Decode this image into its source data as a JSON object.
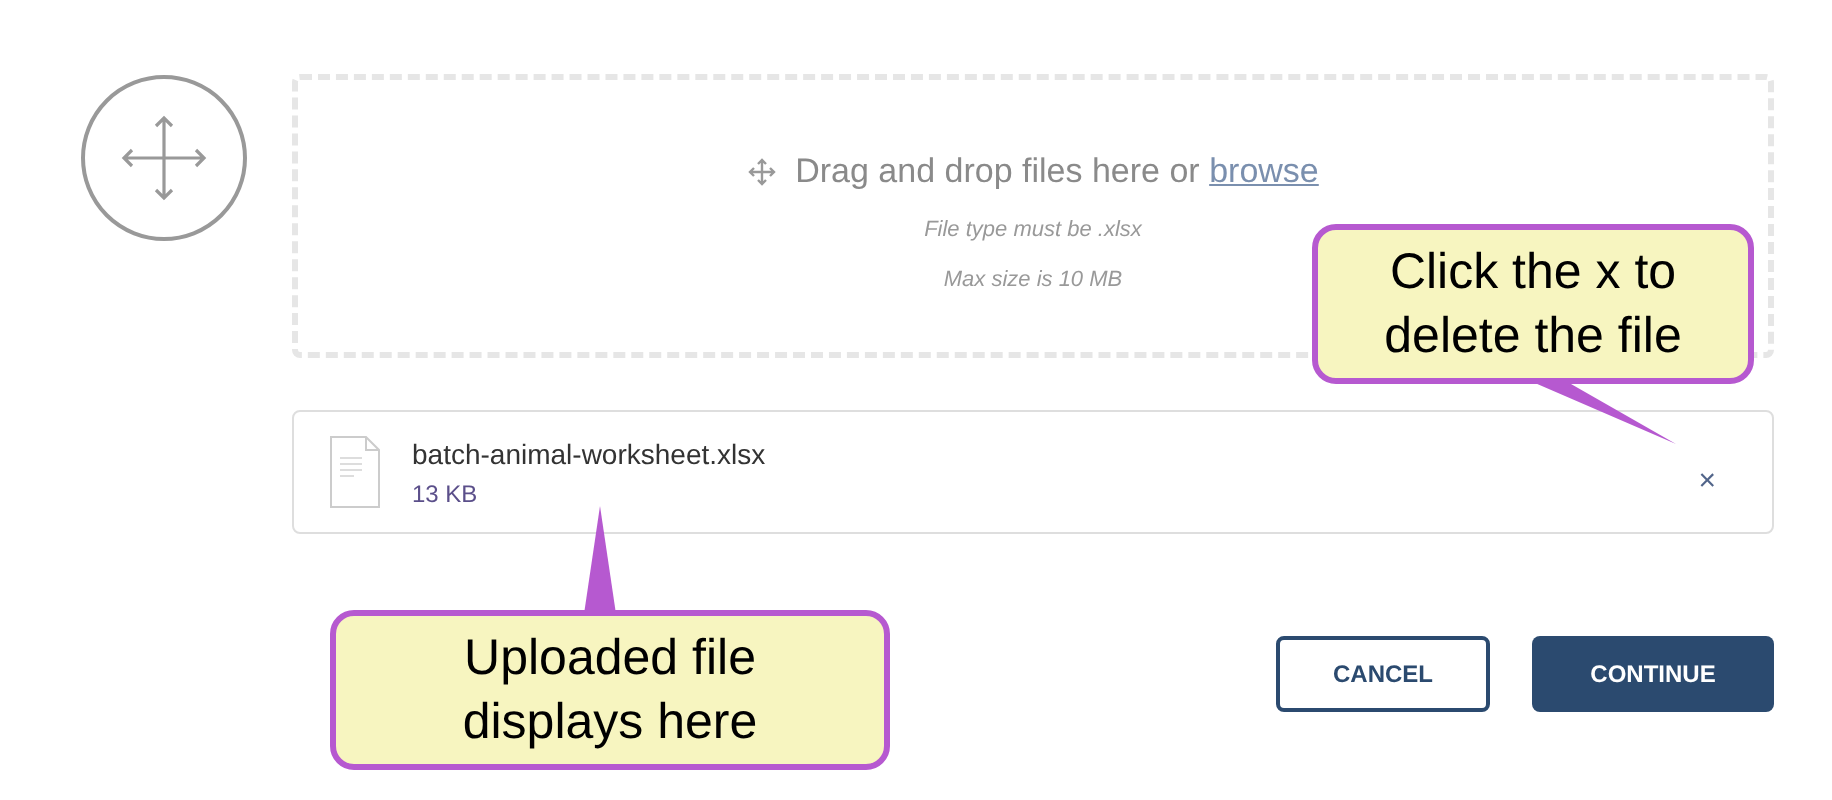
{
  "dropzone": {
    "prompt": "Drag and drop files here or",
    "link": "browse",
    "notes": [
      "File type must be .xlsx",
      "Max size is 10 MB"
    ]
  },
  "file": {
    "name": "batch-animal-worksheet.xlsx",
    "size": "13 KB",
    "remove": "×"
  },
  "buttons": [
    {
      "label": "CANCEL",
      "kind": "secondary"
    },
    {
      "label": "CONTINUE",
      "kind": "primary"
    }
  ],
  "callouts": [
    {
      "text": "Click the x to delete the file",
      "kind": "remove"
    },
    {
      "text": "Uploaded file displays here",
      "kind": "file"
    }
  ]
}
